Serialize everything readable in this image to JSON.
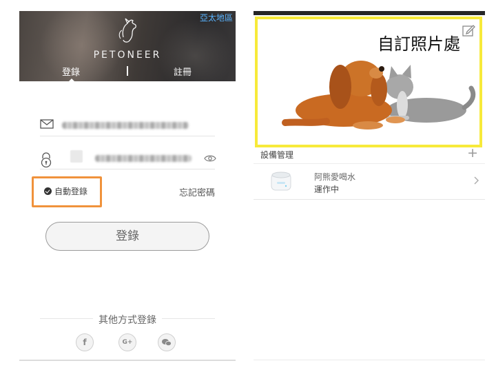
{
  "left_screen": {
    "region": "亞太地區",
    "brand": "PETONEER",
    "tabs": {
      "login": "登錄",
      "register": "註冊"
    },
    "remember_label": "自動登錄",
    "forgot_label": "忘記密碼",
    "login_button": "登錄",
    "other_login_label": "其他方式登錄",
    "social_icons": [
      "facebook-icon",
      "google-plus-icon",
      "wechat-icon"
    ],
    "highlight_color": "#f0923b"
  },
  "right_screen": {
    "photo_caption": "自訂照片處",
    "highlight_color": "#f7ea3a",
    "device_section_title": "設備管理",
    "add_symbol": "+",
    "device": {
      "name": "阿熊愛喝水",
      "status": "運作中"
    }
  }
}
